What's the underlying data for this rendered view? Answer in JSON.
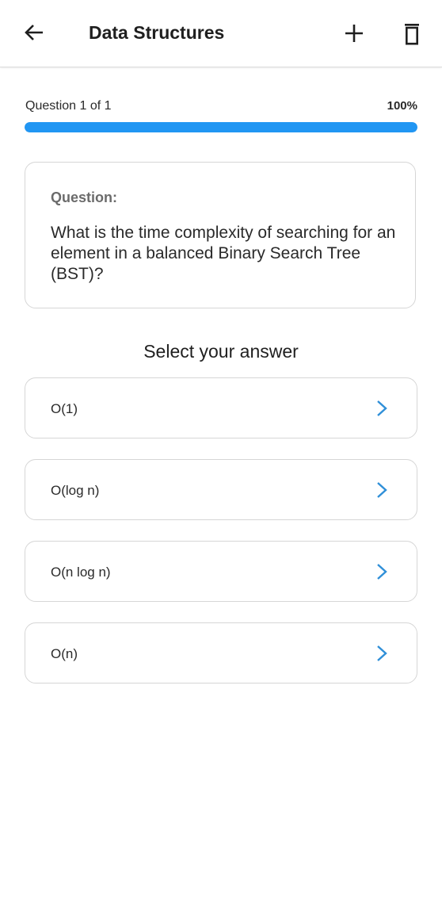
{
  "header": {
    "title": "Data Structures",
    "back_icon": "arrow-left-icon",
    "add_icon": "plus-icon",
    "delete_icon": "trash-icon"
  },
  "progress": {
    "label": "Question 1 of 1",
    "percent_label": "100%",
    "fraction": 1.0,
    "fill_color": "#2196F3"
  },
  "question": {
    "heading": "Question:",
    "text": "What is the time complexity of searching for an element in a balanced Binary Search Tree (BST)?"
  },
  "answers": {
    "title": "Select your answer",
    "options": [
      {
        "label": "O(1)",
        "icon": "chevron-right-icon"
      },
      {
        "label": "O(log n)",
        "icon": "chevron-right-icon"
      },
      {
        "label": "O(n log n)",
        "icon": "chevron-right-icon"
      },
      {
        "label": "O(n)",
        "icon": "chevron-right-icon"
      }
    ]
  },
  "colors": {
    "accent": "#2196F3",
    "chevron": "#2f8fd8"
  }
}
